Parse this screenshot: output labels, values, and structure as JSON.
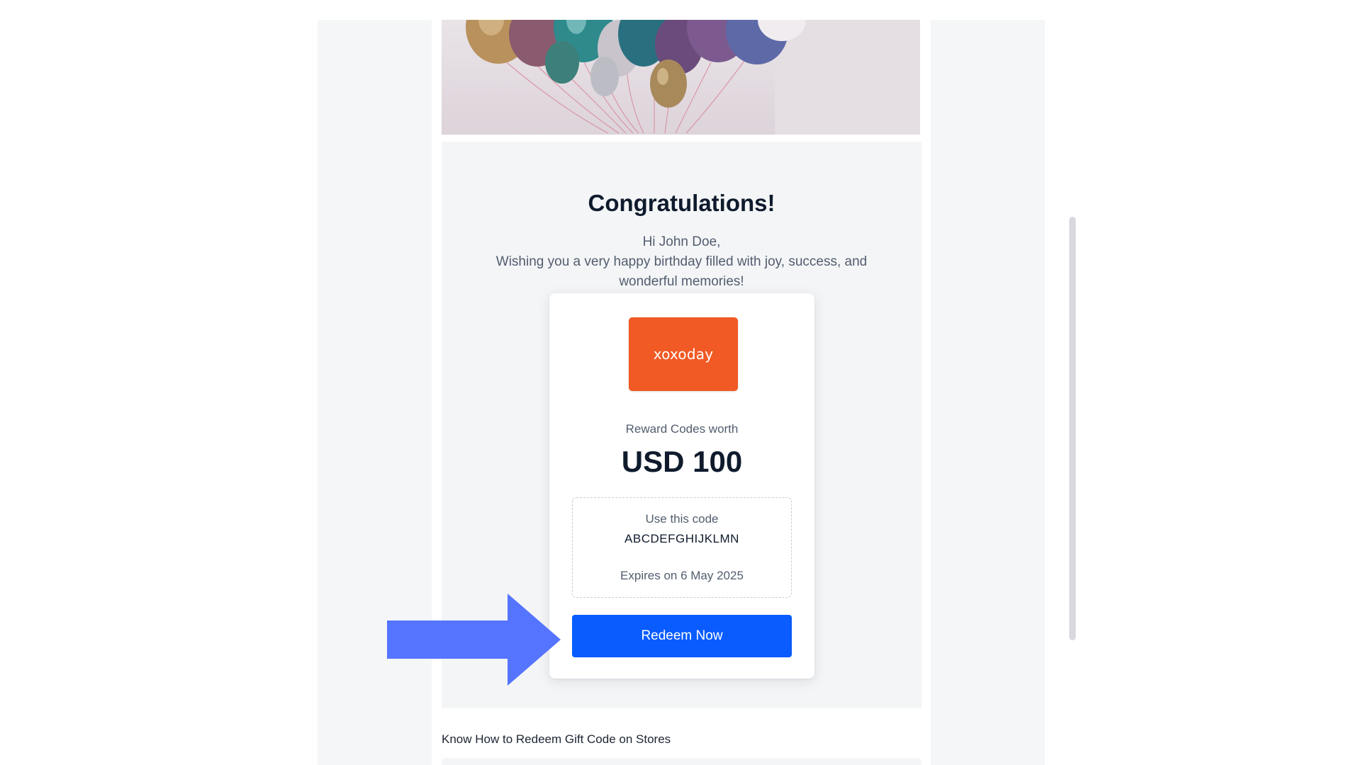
{
  "email": {
    "hero_alt": "balloons",
    "title": "Congratulations!",
    "greeting_line": "Hi John Doe,",
    "message": "Wishing you a very happy birthday filled with joy, success, and wonderful memories!",
    "brand": {
      "logo_text": "xoxoday",
      "color": "#f15a24"
    },
    "worth_label": "Reward Codes worth",
    "amount": "USD 100",
    "code_label": "Use this code",
    "code_value": "ABCDEFGHIJKLMN",
    "expires": "Expires on 6 May 2025",
    "redeem_label": "Redeem Now",
    "footer_heading": "Know How to Redeem Gift Code on Stores"
  },
  "colors": {
    "accent": "#0a5cff",
    "arrow": "#5574ff",
    "brand": "#f15a24"
  }
}
